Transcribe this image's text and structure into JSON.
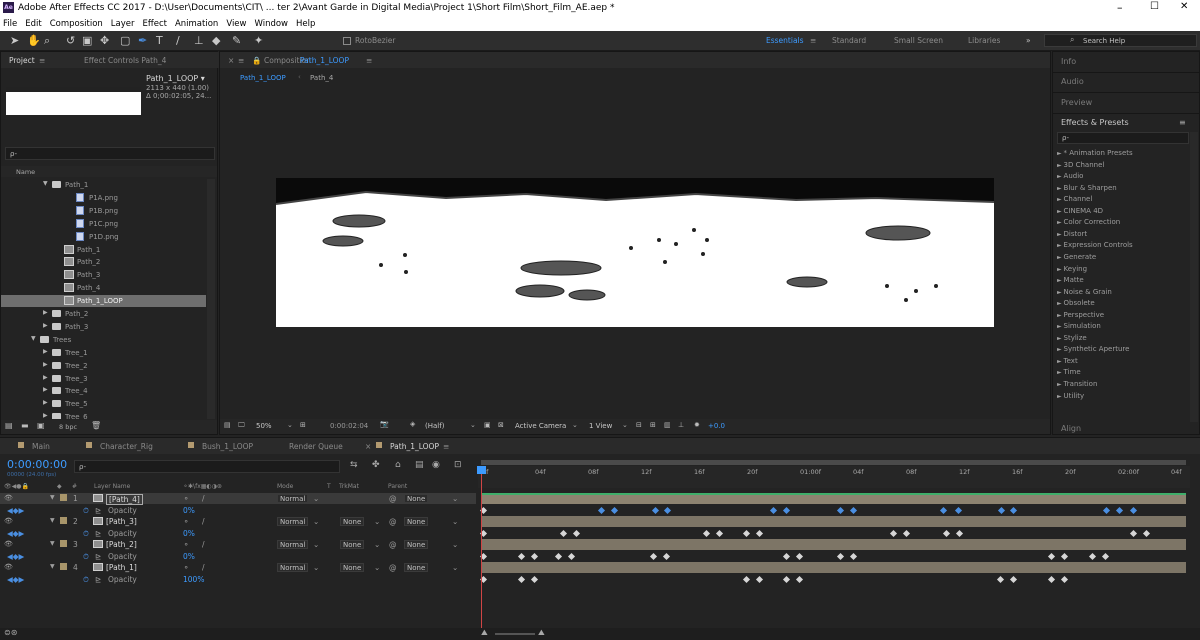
{
  "app": {
    "title": "Adobe After Effects CC 2017 - D:\\User\\Documents\\CIT\\ ... ter 2\\Avant Garde in Digital Media\\Project 1\\Short Film\\Short_Film_AE.aep *",
    "icon": "Ae"
  },
  "window_controls": [
    "–",
    "☐",
    "✕"
  ],
  "menu": [
    "File",
    "Edit",
    "Composition",
    "Layer",
    "Effect",
    "Animation",
    "View",
    "Window",
    "Help"
  ],
  "toolbar": {
    "rotobezier": "RotoBezier",
    "workspaces": [
      "Essentials",
      "Standard",
      "Small Screen",
      "Libraries"
    ],
    "search_placeholder": "Search Help"
  },
  "project_panel": {
    "tabs": [
      "Project",
      "Effect Controls Path_4"
    ],
    "comp_name": "Path_1_LOOP ▾",
    "comp_size": "2113 x 440 (1.00)",
    "comp_duration": "Δ 0;00:02:05, 24...",
    "search_placeholder": "ρ-",
    "column": "Name",
    "tree": [
      {
        "label": "Path_1",
        "type": "folder",
        "indent": 1,
        "open": true
      },
      {
        "label": "P1A.png",
        "type": "png",
        "indent": 3
      },
      {
        "label": "P1B.png",
        "type": "png",
        "indent": 3
      },
      {
        "label": "P1C.png",
        "type": "png",
        "indent": 3
      },
      {
        "label": "P1D.png",
        "type": "png",
        "indent": 3
      },
      {
        "label": "Path_1",
        "type": "comp",
        "indent": 2
      },
      {
        "label": "Path_2",
        "type": "comp",
        "indent": 2
      },
      {
        "label": "Path_3",
        "type": "comp",
        "indent": 2
      },
      {
        "label": "Path_4",
        "type": "comp",
        "indent": 2
      },
      {
        "label": "Path_1_LOOP",
        "type": "comp",
        "indent": 2,
        "selected": true
      },
      {
        "label": "Path_2",
        "type": "folder",
        "indent": 1
      },
      {
        "label": "Path_3",
        "type": "folder",
        "indent": 1
      },
      {
        "label": "Trees",
        "type": "folder",
        "indent": 0,
        "open": true
      },
      {
        "label": "Tree_1",
        "type": "folder",
        "indent": 1
      },
      {
        "label": "Tree_2",
        "type": "folder",
        "indent": 1
      },
      {
        "label": "Tree_3",
        "type": "folder",
        "indent": 1
      },
      {
        "label": "Tree_4",
        "type": "folder",
        "indent": 1
      },
      {
        "label": "Tree_5",
        "type": "folder",
        "indent": 1
      },
      {
        "label": "Tree_6",
        "type": "folder",
        "indent": 1
      }
    ],
    "bpc": "8 bpc"
  },
  "comp_panel": {
    "tab_label": "Composition",
    "tab_name": "Path_1_LOOP",
    "breadcrumbs": [
      "Path_1_LOOP",
      "Path_4"
    ],
    "footer": {
      "zoom": "50%",
      "timecode": "0:00:02:04",
      "resolution": "(Half)",
      "camera": "Active Camera",
      "view": "1 View",
      "exposure": "+0.0"
    }
  },
  "right_panel": {
    "sections": [
      "Info",
      "Audio",
      "Preview"
    ],
    "effects_title": "Effects & Presets",
    "search_placeholder": "ρ-",
    "effects": [
      "* Animation Presets",
      "3D Channel",
      "Audio",
      "Blur & Sharpen",
      "Channel",
      "CINEMA 4D",
      "Color Correction",
      "Distort",
      "Expression Controls",
      "Generate",
      "Keying",
      "Matte",
      "Noise & Grain",
      "Obsolete",
      "Perspective",
      "Simulation",
      "Stylize",
      "Synthetic Aperture",
      "Text",
      "Time",
      "Transition",
      "Utility"
    ],
    "align": "Align"
  },
  "timeline": {
    "tabs": [
      "Main",
      "Character_Rig",
      "Bush_1_LOOP",
      "Render Queue",
      "Path_1_LOOP"
    ],
    "active_tab": "Path_1_LOOP",
    "timecode": "0:00:00:00",
    "frame_info": "00000 (24.00 fps)",
    "search_placeholder": "ρ-",
    "columns": {
      "num": "#",
      "layer_name": "Layer Name",
      "mode": "Mode",
      "t": "T",
      "trkmat": "TrkMat",
      "parent": "Parent"
    },
    "ruler": [
      "0f",
      "04f",
      "08f",
      "12f",
      "16f",
      "20f",
      "01:00f",
      "04f",
      "08f",
      "12f",
      "16f",
      "20f",
      "02:00f",
      "04f"
    ],
    "layers": [
      {
        "num": "1",
        "name": "[Path_4]",
        "mode": "Normal",
        "trkmat": "",
        "parent": "None",
        "prop": "Opacity",
        "value": "0%",
        "selected": true
      },
      {
        "num": "2",
        "name": "[Path_3]",
        "mode": "Normal",
        "trkmat": "None",
        "parent": "None",
        "prop": "Opacity",
        "value": "0%"
      },
      {
        "num": "3",
        "name": "[Path_2]",
        "mode": "Normal",
        "trkmat": "None",
        "parent": "None",
        "prop": "Opacity",
        "value": "0%"
      },
      {
        "num": "4",
        "name": "[Path_1]",
        "mode": "Normal",
        "trkmat": "None",
        "parent": "None",
        "prop": "Opacity",
        "value": "100%"
      }
    ]
  },
  "colors": {
    "accent": "#2d8ceb",
    "panel": "#232323",
    "track": "#7d7566",
    "layer_label": "#a8956a"
  }
}
